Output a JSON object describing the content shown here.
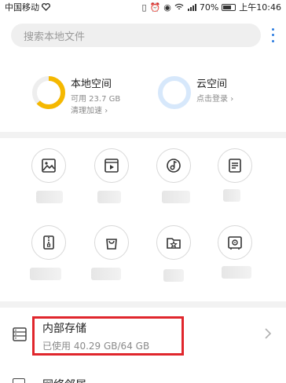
{
  "status_bar": {
    "carrier": "中国移动",
    "heart_icon": "heart-icon",
    "signal_label": "4G",
    "battery": "70%",
    "battery_level": 0.7,
    "time": "上午10:46"
  },
  "search": {
    "placeholder": "搜索本地文件"
  },
  "storage_cards": {
    "local": {
      "title": "本地空间",
      "available": "可用 23.7 GB",
      "action": "清理加速",
      "ring_color": "#f5b800",
      "used_fraction": 0.63
    },
    "cloud": {
      "title": "云空间",
      "action": "点击登录",
      "ring_color": "#d7e8fb"
    }
  },
  "categories": [
    {
      "icon": "image-icon"
    },
    {
      "icon": "video-icon"
    },
    {
      "icon": "music-icon"
    },
    {
      "icon": "document-icon"
    },
    {
      "icon": "zip-icon"
    },
    {
      "icon": "shopping-bag-icon"
    },
    {
      "icon": "star-folder-icon"
    },
    {
      "icon": "safe-icon"
    }
  ],
  "internal_storage": {
    "title": "内部存储",
    "usage": "已使用 40.29 GB/64 GB"
  },
  "next_item": {
    "label": "网络邻居"
  },
  "colors": {
    "accent": "#2a7be0",
    "highlight": "#e0262c",
    "ring_local": "#f5b800",
    "ring_cloud": "#d7e8fb"
  }
}
